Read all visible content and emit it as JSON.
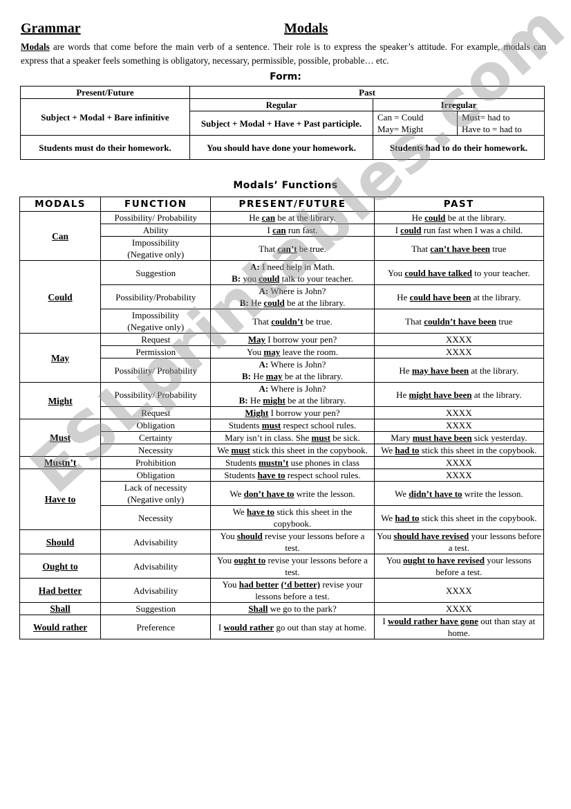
{
  "header": {
    "left_title": "Grammar",
    "center_title": "Modals"
  },
  "intro": {
    "lead": "Modals",
    "text": " are words that come before the main verb of a sentence. Their role is to express the speaker’s attitude. For example, modals can express that a speaker feels something is obligatory, necessary, permissible, possible, probable… etc."
  },
  "form": {
    "heading": "Form:",
    "present_future_header": "Present/Future",
    "past_header": "Past",
    "regular_header": "Regular",
    "irregular_header": "Irregular",
    "present_rule": "Subject + Modal + Bare infinitive",
    "regular_rule": "Subject + Modal + Have + Past participle.",
    "irregular": [
      [
        "Can = Could",
        "May= Might"
      ],
      [
        "Must= had to",
        "Have to = had to"
      ]
    ],
    "present_example": "Students must do their homework.",
    "regular_example": "You should have done your homework.",
    "irregular_example": "Students had to do their homework."
  },
  "functions": {
    "heading": "Modals’ Functions",
    "columns": [
      "MODALS",
      "FUNCTION",
      "PRESENT/FUTURE",
      "PAST"
    ],
    "groups": [
      {
        "modal": "Can",
        "rows": [
          {
            "function": "Possibility/ Probability",
            "present": "He <b><u>can</u></b> be at the library.",
            "past": "He <b><u>could</u></b> be at the library."
          },
          {
            "function": "Ability",
            "present": "I <b><u>can</u></b> run fast.",
            "past": "I <b><u>could</u></b> run fast when I was a child."
          },
          {
            "function": "Impossibility<br>(Negative only)",
            "present": "That <b><u>can’t</u></b> be true.",
            "past": "That <b><u>can’t have been</u></b> true"
          }
        ]
      },
      {
        "modal": "Could",
        "rows": [
          {
            "function": "Suggestion",
            "present": "<b>A:</b> I need help in Math.<br><b>B:</b> you <b><u>could</u></b> talk to your teacher.",
            "past": "You <b><u>could have talked</u></b> to your teacher."
          },
          {
            "function": "Possibility/Probability",
            "present": "<b>A:</b> Where is John?<br><b>B:</b> He <b><u>could</u></b> be at the library.",
            "past": "He <b><u>could have been</u></b> at the library."
          },
          {
            "function": "Impossibility<br>(Negative only)",
            "present": "That <b><u>couldn’t</u></b> be true.",
            "past": "That <b><u>couldn’t have been</u></b> true"
          }
        ]
      },
      {
        "modal": "May",
        "rows": [
          {
            "function": "Request",
            "present": "<b><u>May</u></b> I borrow your pen?",
            "past": "XXXX"
          },
          {
            "function": "Permission",
            "present": "You <b><u>may</u></b> leave the room.",
            "past": "XXXX"
          },
          {
            "function": "Possibility/ Probability",
            "present": "<b>A:</b> Where is John?<br><b>B:</b> He <b><u>may</u></b> be at the library.",
            "past": "He <b><u>may have been</u></b> at the library."
          }
        ]
      },
      {
        "modal": "Might",
        "rows": [
          {
            "function": "Possibility/ Probability",
            "present": "<b>A:</b> Where is John?<br><b>B:</b> He <b><u>might</u></b> be at the library.",
            "past": "He <b><u>might have been</u></b> at the library."
          },
          {
            "function": "Request",
            "present": "<b><u>Might</u></b> I borrow your pen?",
            "past": "XXXX"
          }
        ]
      },
      {
        "modal": "Must",
        "rows": [
          {
            "function": "Obligation",
            "present": "Students <b><u>must</u></b> respect school rules.",
            "past": "XXXX"
          },
          {
            "function": "Certainty",
            "present": "Mary isn’t in class. She <b><u>must</u></b> be sick.",
            "past": "Mary <b><u>must have been</u></b> sick yesterday."
          },
          {
            "function": "Necessity",
            "present": "We <b><u>must</u></b> stick this sheet in the copybook.",
            "past": "We <b><u>had to</u></b> stick this sheet in the copybook."
          }
        ]
      },
      {
        "modal": "Mustn’t",
        "rows": [
          {
            "function": "Prohibition",
            "present": "Students <b><u>mustn’t</u></b> use phones in class",
            "past": "XXXX"
          }
        ]
      },
      {
        "modal": "Have to",
        "rows": [
          {
            "function": "Obligation",
            "present": "Students <b><u>have to</u></b> respect school rules.",
            "past": "XXXX"
          },
          {
            "function": "Lack of necessity<br>(Negative only)",
            "present": "We <b><u>don’t have to</u></b> write the lesson.",
            "past": "We <b><u>didn’t have to</u></b> write the lesson."
          },
          {
            "function": "Necessity",
            "present": "We <b><u>have to</u></b> stick this sheet in the copybook.",
            "past": "We <b><u>had to</u></b> stick this sheet in the copybook."
          }
        ]
      },
      {
        "modal": "Should",
        "rows": [
          {
            "function": "Advisability",
            "present": "You <b><u>should</u></b> revise your lessons before a test.",
            "past": "You <b><u>should have revised</u></b> your lessons before a test."
          }
        ]
      },
      {
        "modal": "Ought to",
        "rows": [
          {
            "function": "Advisability",
            "present": "You <b><u>ought to</u></b> revise your lessons before a test.",
            "past": "You <b><u>ought to have revised</u></b> your lessons before a test."
          }
        ]
      },
      {
        "modal": "Had better",
        "rows": [
          {
            "function": "Advisability",
            "present": "You <b><u>had better</u></b> <b><u>(‘d better)</u></b> revise your lessons before a test.",
            "past": "XXXX"
          }
        ]
      },
      {
        "modal": "Shall",
        "rows": [
          {
            "function": "Suggestion",
            "present": "<b><u>Shall</u></b> we go to the park?",
            "past": "XXXX"
          }
        ]
      },
      {
        "modal": "Would rather",
        "rows": [
          {
            "function": "Preference",
            "present": "I <b><u>would rather</u></b> go out than stay at home.",
            "past": "I <b><u>would rather have gone</u></b> out than stay at home."
          }
        ]
      }
    ]
  },
  "watermark": "ESLprintables.com"
}
